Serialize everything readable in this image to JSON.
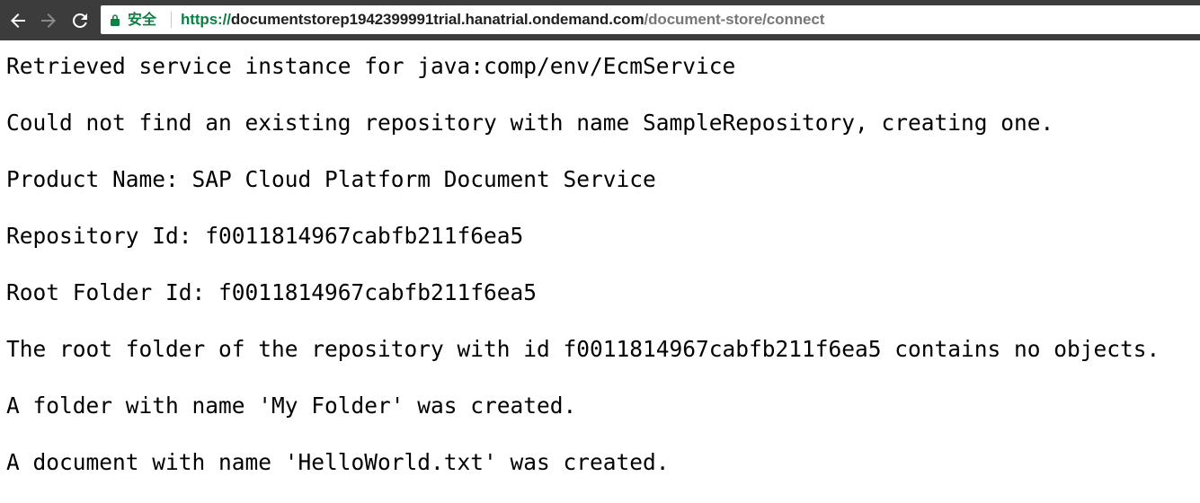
{
  "browser": {
    "back_icon": "arrow-left-icon",
    "forward_icon": "arrow-right-icon",
    "reload_icon": "reload-icon",
    "lock_icon": "lock-icon",
    "secure_label": "安全",
    "url": {
      "scheme": "https://",
      "host": "documentstorep1942399991trial.hanatrial.ondemand.com",
      "path": "/document-store/connect"
    },
    "colors": {
      "toolbar_bg": "#3c3c3c",
      "secure_green": "#0b8043",
      "path_gray": "#777777"
    }
  },
  "page": {
    "lines": [
      "Retrieved service instance for java:comp/env/EcmService",
      "Could not find an existing repository with name SampleRepository, creating one.",
      "Product Name: SAP Cloud Platform Document Service",
      "Repository Id: f0011814967cabfb211f6ea5",
      "Root Folder Id: f0011814967cabfb211f6ea5",
      "The root folder of the repository with id f0011814967cabfb211f6ea5 contains no objects.",
      "A folder with name 'My Folder' was created.",
      "A document with name 'HelloWorld.txt' was created."
    ]
  }
}
